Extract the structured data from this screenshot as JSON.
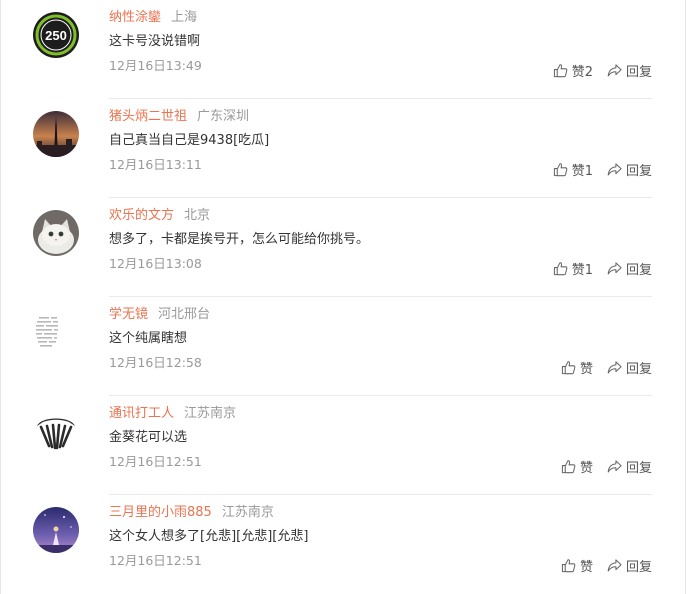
{
  "comments": [
    {
      "user": "纳性涂鑾",
      "location": "上海",
      "text": "这卡号没说错啊",
      "time": "12月16日13:49",
      "like_label": "赞2",
      "reply_label": "回复",
      "avatar": {
        "icon": "badge-250-icon",
        "badge_text": "250",
        "accent": "#7fbf2a"
      }
    },
    {
      "user": "猪头炳二世祖",
      "location": "广东深圳",
      "text": "自己真当自己是9438[吃瓜]",
      "time": "12月16日13:11",
      "like_label": "赞1",
      "reply_label": "回复",
      "avatar": {
        "icon": "city-tower-sunset-icon"
      }
    },
    {
      "user": "欢乐的文方",
      "location": "北京",
      "text": "想多了，卡都是挨号开，怎么可能给你挑号。",
      "time": "12月16日13:08",
      "like_label": "赞1",
      "reply_label": "回复",
      "avatar": {
        "icon": "cat-photo-icon"
      }
    },
    {
      "user": "学无镜",
      "location": "河北邢台",
      "text": "这个纯属瞎想",
      "time": "12月16日12:58",
      "like_label": "赞",
      "reply_label": "回复",
      "avatar": {
        "icon": "text-sketch-icon"
      }
    },
    {
      "user": "通讯打工人",
      "location": "江苏南京",
      "text": "金葵花可以选",
      "time": "12月16日12:51",
      "like_label": "赞",
      "reply_label": "回复",
      "avatar": {
        "icon": "fan-logo-icon"
      }
    },
    {
      "user": "三月里的小雨885",
      "location": "江苏南京",
      "text": "这个女人想多了[允悲][允悲][允悲]",
      "time": "12月16日12:51",
      "like_label": "赞",
      "reply_label": "回复",
      "avatar": {
        "icon": "night-figure-icon"
      }
    }
  ],
  "colors": {
    "username": "#eb7350",
    "meta": "#999999",
    "text": "#333333"
  }
}
